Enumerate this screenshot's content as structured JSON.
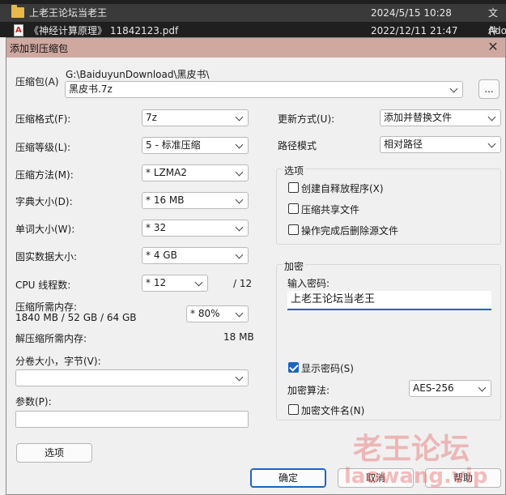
{
  "explorer": {
    "files": [
      {
        "name": "上老王论坛当老王",
        "date": "2024/5/15 10:28",
        "type": "文件"
      },
      {
        "name": "《神经计算原理》 11842123.pdf",
        "date": "2022/12/11 21:47",
        "type": "Ado"
      }
    ]
  },
  "dialog": {
    "title": "添加到压缩包",
    "close_glyph": "✕",
    "archive_label": "压缩包(A)",
    "archive_path": "G:\\BaiduyunDownload\\黑皮书\\",
    "archive_name": "黑皮书.7z",
    "browse_label": "...",
    "format_label": "压缩格式(F):",
    "format_value": "7z",
    "level_label": "压缩等级(L):",
    "level_value": "5 - 标准压缩",
    "method_label": "压缩方法(M):",
    "method_value": "*  LZMA2",
    "dict_label": "字典大小(D):",
    "dict_value": "*  16 MB",
    "word_label": "单词大小(W):",
    "word_value": "*  32",
    "solid_label": "固实数据大小:",
    "solid_value": "*  4 GB",
    "cpu_label": "CPU 线程数:",
    "cpu_value": "*  12",
    "cpu_max": "/ 12",
    "mem_label": "压缩所需内存:",
    "mem_value": "1840 MB / 52 GB / 64 GB",
    "mem_percent": "*  80%",
    "decomp_label": "解压缩所需内存:",
    "decomp_value": "18 MB",
    "split_label": "分卷大小，字节(V):",
    "split_value": "",
    "params_label": "参数(P):",
    "params_value": "",
    "options_button": "选项",
    "update_label": "更新方式(U):",
    "update_value": "添加并替换文件",
    "path_label": "路径模式",
    "path_value": "相对路径",
    "options_group": "选项",
    "opt_sfx": "创建自释放程序(X)",
    "opt_shared": "压缩共享文件",
    "opt_delete": "操作完成后删除源文件",
    "encrypt_group": "加密",
    "password_label": "输入密码:",
    "password_value": "上老王论坛当老王",
    "show_password": "显示密码(S)",
    "enc_method_label": "加密算法:",
    "enc_method_value": "AES-256",
    "encrypt_names": "加密文件名(N)",
    "ok_button": "确定",
    "cancel_button": "取消",
    "help_button": "帮助"
  },
  "watermark": {
    "line1": "老王论坛",
    "line2": "laowang.vip"
  },
  "colors": {
    "accent": "#1c64c4",
    "titlebar": "#cfa8a0",
    "watermark": "#e66e6e"
  }
}
